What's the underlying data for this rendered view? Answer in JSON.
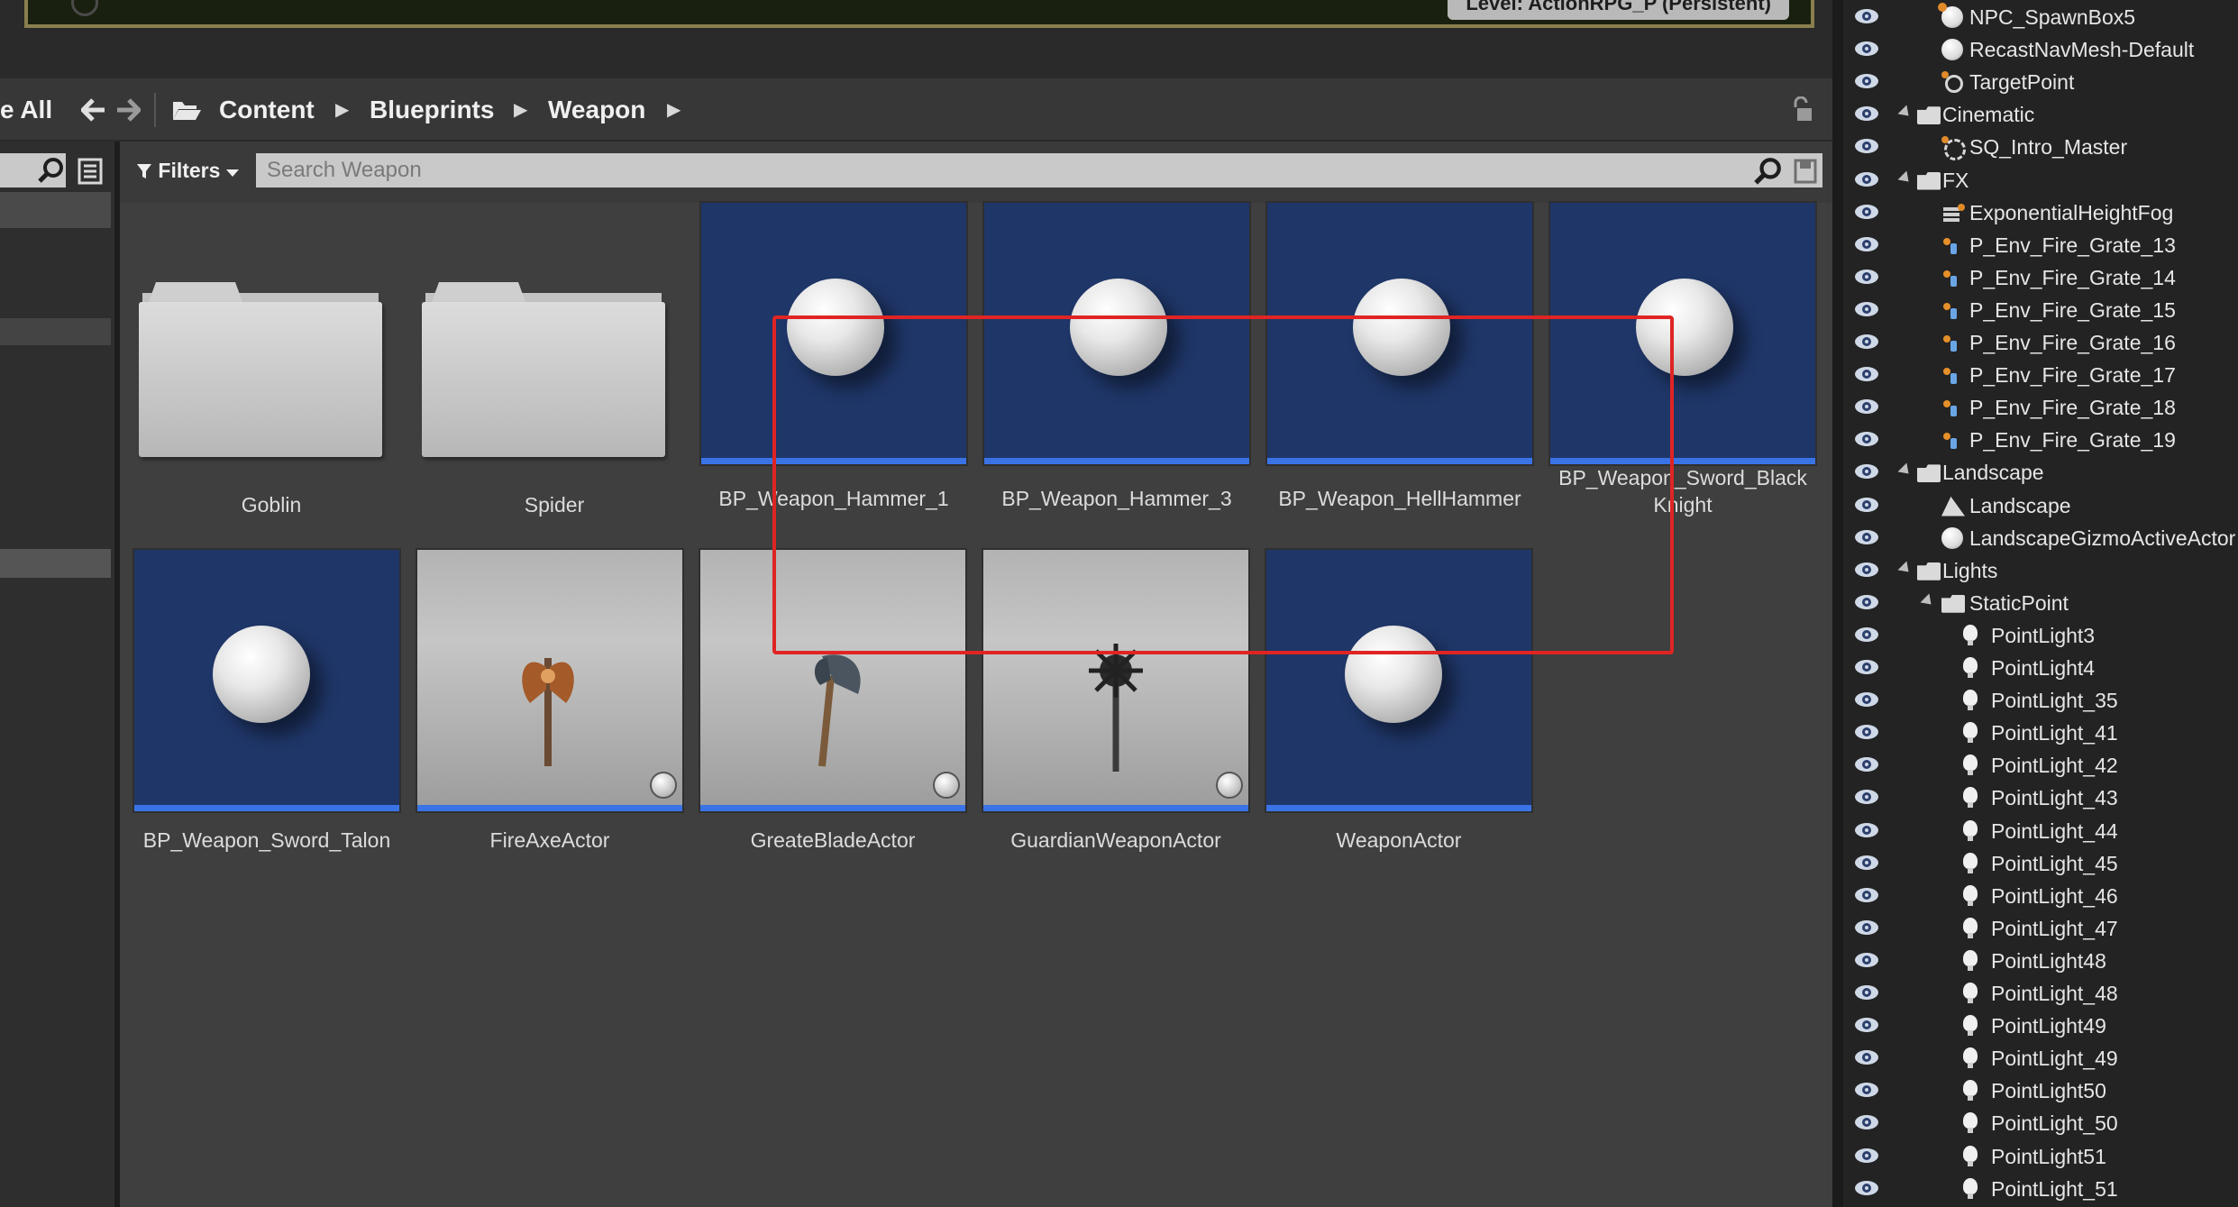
{
  "toolbar": {
    "save_all_label": "e All",
    "level_label": "Level:  ActionRPG_P (Persistent)"
  },
  "breadcrumb": {
    "items": [
      "Content",
      "Blueprints",
      "Weapon"
    ]
  },
  "filterbar": {
    "filters_label": "Filters",
    "search_placeholder": "Search Weapon"
  },
  "assets": [
    {
      "name": "Goblin",
      "kind": "folder"
    },
    {
      "name": "Spider",
      "kind": "folder"
    },
    {
      "name": "BP_Weapon_Hammer_1",
      "kind": "blueprint"
    },
    {
      "name": "BP_Weapon_Hammer_3",
      "kind": "blueprint"
    },
    {
      "name": "BP_Weapon_HellHammer",
      "kind": "blueprint"
    },
    {
      "name": "BP_Weapon_Sword_Black Knight",
      "kind": "blueprint"
    },
    {
      "name": "BP_Weapon_Sword_Talon",
      "kind": "blueprint"
    },
    {
      "name": "FireAxeActor",
      "kind": "actor-axe"
    },
    {
      "name": "GreateBladeActor",
      "kind": "actor-blade"
    },
    {
      "name": "GuardianWeaponActor",
      "kind": "actor-mace"
    },
    {
      "name": "WeaponActor",
      "kind": "blueprint"
    }
  ],
  "colors": {
    "accent_bar": "#3a73e6",
    "highlight_box": "#e02424",
    "thumb_bg": "#1f3668"
  },
  "outliner": {
    "rows": [
      {
        "label": "NPC_SpawnBox5",
        "icon": "spawn-icon",
        "depth": 2
      },
      {
        "label": "RecastNavMesh-Default",
        "icon": "sphere-icon",
        "depth": 2
      },
      {
        "label": "TargetPoint",
        "icon": "target-icon",
        "depth": 2
      },
      {
        "label": "Cinematic",
        "icon": "folder-icon",
        "depth": 1,
        "expanded": true
      },
      {
        "label": "SQ_Intro_Master",
        "icon": "sequence-icon",
        "depth": 2
      },
      {
        "label": "FX",
        "icon": "folder-icon",
        "depth": 1,
        "expanded": true
      },
      {
        "label": "ExponentialHeightFog",
        "icon": "fog-icon",
        "depth": 2
      },
      {
        "label": "P_Env_Fire_Grate_13",
        "icon": "particle-icon",
        "depth": 2
      },
      {
        "label": "P_Env_Fire_Grate_14",
        "icon": "particle-icon",
        "depth": 2
      },
      {
        "label": "P_Env_Fire_Grate_15",
        "icon": "particle-icon",
        "depth": 2
      },
      {
        "label": "P_Env_Fire_Grate_16",
        "icon": "particle-icon",
        "depth": 2
      },
      {
        "label": "P_Env_Fire_Grate_17",
        "icon": "particle-icon",
        "depth": 2
      },
      {
        "label": "P_Env_Fire_Grate_18",
        "icon": "particle-icon",
        "depth": 2
      },
      {
        "label": "P_Env_Fire_Grate_19",
        "icon": "particle-icon",
        "depth": 2
      },
      {
        "label": "Landscape",
        "icon": "folder-icon",
        "depth": 1,
        "expanded": true
      },
      {
        "label": "Landscape",
        "icon": "landscape-icon",
        "depth": 2
      },
      {
        "label": "LandscapeGizmoActiveActor",
        "icon": "sphere-icon",
        "depth": 2
      },
      {
        "label": "Lights",
        "icon": "folder-icon",
        "depth": 1,
        "expanded": true
      },
      {
        "label": "StaticPoint",
        "icon": "folder-icon",
        "depth": 2,
        "expanded": true
      },
      {
        "label": "PointLight3",
        "icon": "pointlight-icon",
        "depth": 3
      },
      {
        "label": "PointLight4",
        "icon": "pointlight-icon",
        "depth": 3
      },
      {
        "label": "PointLight_35",
        "icon": "pointlight-icon",
        "depth": 3
      },
      {
        "label": "PointLight_41",
        "icon": "pointlight-icon",
        "depth": 3
      },
      {
        "label": "PointLight_42",
        "icon": "pointlight-icon",
        "depth": 3
      },
      {
        "label": "PointLight_43",
        "icon": "pointlight-icon",
        "depth": 3
      },
      {
        "label": "PointLight_44",
        "icon": "pointlight-icon",
        "depth": 3
      },
      {
        "label": "PointLight_45",
        "icon": "pointlight-icon",
        "depth": 3
      },
      {
        "label": "PointLight_46",
        "icon": "pointlight-icon",
        "depth": 3
      },
      {
        "label": "PointLight_47",
        "icon": "pointlight-icon",
        "depth": 3
      },
      {
        "label": "PointLight48",
        "icon": "pointlight-icon",
        "depth": 3
      },
      {
        "label": "PointLight_48",
        "icon": "pointlight-icon",
        "depth": 3
      },
      {
        "label": "PointLight49",
        "icon": "pointlight-icon",
        "depth": 3
      },
      {
        "label": "PointLight_49",
        "icon": "pointlight-icon",
        "depth": 3
      },
      {
        "label": "PointLight50",
        "icon": "pointlight-icon",
        "depth": 3
      },
      {
        "label": "PointLight_50",
        "icon": "pointlight-icon",
        "depth": 3
      },
      {
        "label": "PointLight51",
        "icon": "pointlight-icon",
        "depth": 3
      },
      {
        "label": "PointLight_51",
        "icon": "pointlight-icon",
        "depth": 3
      }
    ]
  }
}
